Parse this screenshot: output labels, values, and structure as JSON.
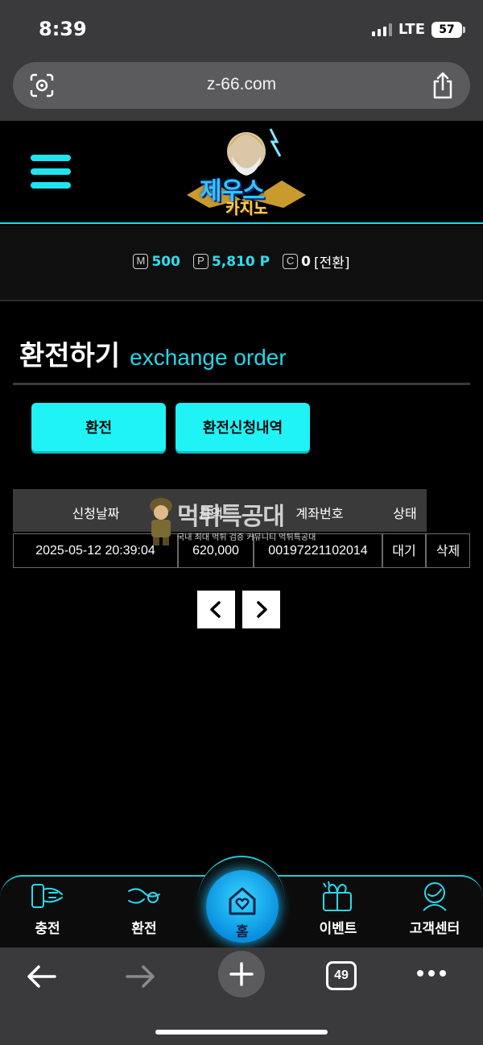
{
  "status_bar": {
    "time": "8:39",
    "network": "LTE",
    "battery": "57"
  },
  "browser": {
    "url": "z-66.com",
    "tab_count": "49"
  },
  "header": {
    "logo_line1": "제우스",
    "logo_line2": "카지노"
  },
  "points": [
    {
      "icon": "M",
      "value": "500"
    },
    {
      "icon": "P",
      "value": "5,810 P"
    },
    {
      "icon": "C",
      "value": "0",
      "suffix": "[전환]"
    }
  ],
  "page": {
    "title_ko": "환전하기",
    "title_en": "exchange order"
  },
  "buttons": {
    "exchange": "환전",
    "history": "환전신청내역"
  },
  "table": {
    "headers": [
      "신청날짜",
      "금액",
      "계좌번호",
      "상태"
    ],
    "rows": [
      {
        "date": "2025-05-12 20:39:04",
        "amount": "620,000",
        "account": "00197221102014",
        "status": "대기",
        "action": "삭제"
      }
    ]
  },
  "watermark": {
    "title": "먹튀특공대",
    "subtitle": "국내 최대 먹튀 검증 커뮤니티 먹튀특공대"
  },
  "bottom_nav": {
    "charge": "충전",
    "exchange": "환전",
    "home": "홈",
    "event": "이벤트",
    "support": "고객센터"
  },
  "colors": {
    "accent": "#1ff3f6",
    "background": "#000000",
    "browser_chrome": "#3a3a3c"
  }
}
